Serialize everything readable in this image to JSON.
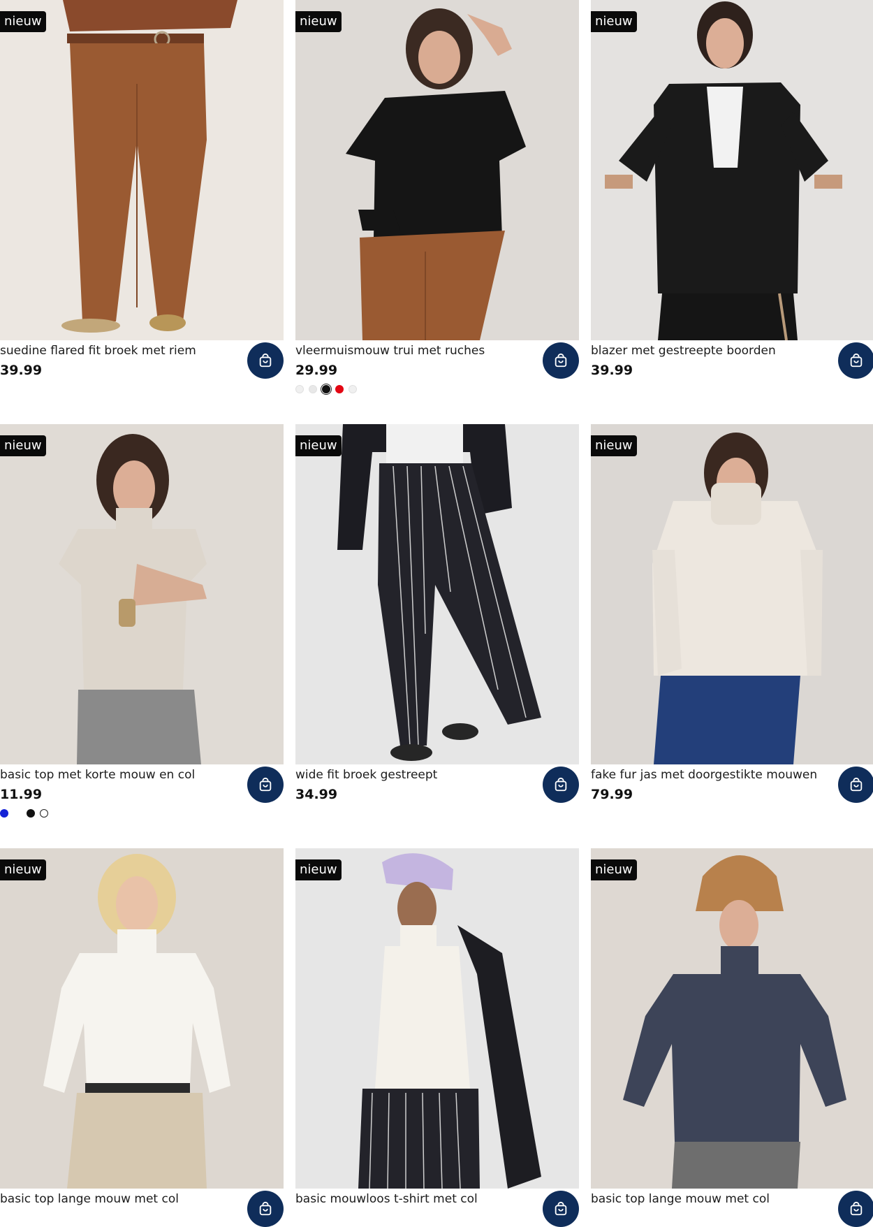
{
  "badge_label": "nieuw",
  "colors": {
    "cart_button": "#0f2d5a",
    "badge": "#0a0a0a"
  },
  "products": [
    {
      "title": "suedine flared fit broek met riem",
      "price": "39.99",
      "image": "brown suede flared trousers with belt, loafers",
      "swatches": []
    },
    {
      "title": "vleermuismouw trui met ruches",
      "price": "29.99",
      "image": "black batwing sweater with ruffled sleeves",
      "swatches": [
        "#f0f0f0",
        "#e8e8e8",
        "#111111",
        "#e30613",
        "#f0f0f0"
      ],
      "selected_swatch": 2
    },
    {
      "title": "blazer met gestreepte boorden",
      "price": "39.99",
      "image": "black blazer with striped cuffs and collar",
      "swatches": []
    },
    {
      "title": "basic top met korte mouw en col",
      "price": "11.99",
      "image": "beige short-sleeve turtleneck top",
      "swatches": [
        "#1422d6",
        "#ffffff",
        "#111111",
        "#ffffff"
      ],
      "outlined_swatch": 3
    },
    {
      "title": "wide fit broek gestreept",
      "price": "34.99",
      "image": "black pinstripe wide leg trousers, studded loafers",
      "swatches": []
    },
    {
      "title": "fake fur jas met doorgestikte mouwen",
      "price": "79.99",
      "image": "cream faux fur jacket with quilted sleeves",
      "swatches": []
    },
    {
      "title": "basic top lange mouw met col",
      "price": "",
      "image": "white long sleeve turtleneck top",
      "swatches": []
    },
    {
      "title": "basic mouwloos t-shirt met col",
      "price": "",
      "image": "white sleeveless turtleneck with lilac cap",
      "swatches": []
    },
    {
      "title": "basic top lange mouw met col",
      "price": "",
      "image": "navy long sleeve turtleneck, teddy bucket hat",
      "swatches": []
    }
  ]
}
